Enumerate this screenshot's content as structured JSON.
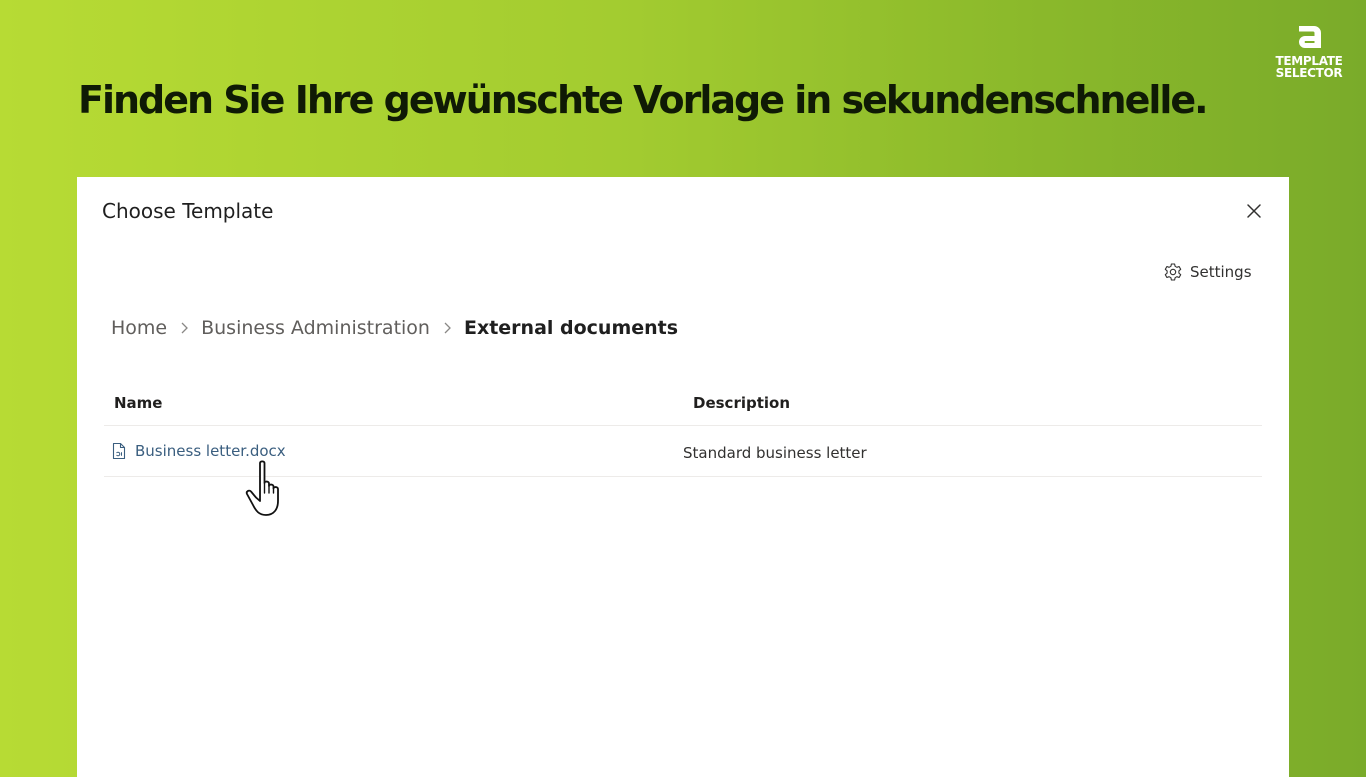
{
  "headline": "Finden Sie Ihre gewünschte Vorlage in sekundenschnelle.",
  "brand": {
    "line1": "TEMPLATE",
    "line2": "SELECTOR",
    "icon": "letter-a-logo"
  },
  "dialog": {
    "title": "Choose Template",
    "close_icon": "close-icon",
    "settings": {
      "label": "Settings",
      "icon": "gear-icon"
    },
    "breadcrumb": [
      {
        "label": "Home"
      },
      {
        "label": "Business Administration"
      },
      {
        "label": "External documents"
      }
    ],
    "table": {
      "columns": [
        "Name",
        "Description"
      ],
      "rows": [
        {
          "name": "Business letter.docx",
          "description": "Standard business letter",
          "icon": "document-icon"
        }
      ]
    }
  },
  "cursor": {
    "icon": "hand-pointer-icon"
  },
  "colors": {
    "background_start": "#b7db34",
    "background_end": "#7aab2a",
    "headline": "#0f1a05",
    "link": "#3a5e7f",
    "dialog_bg": "#ffffff"
  }
}
